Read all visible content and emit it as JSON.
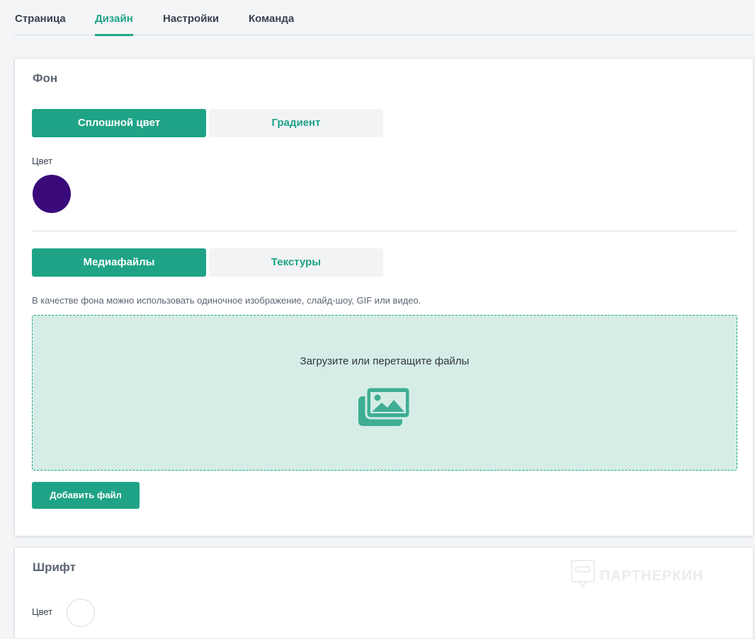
{
  "tabs": [
    {
      "label": "Страница"
    },
    {
      "label": "Дизайн"
    },
    {
      "label": "Настройки"
    },
    {
      "label": "Команда"
    }
  ],
  "background_section": {
    "title": "Фон",
    "color_mode": {
      "solid_label": "Сплошной цвет",
      "gradient_label": "Градиент",
      "selected": "solid"
    },
    "color_label": "Цвет",
    "color_value": "#3a0a7a",
    "media_mode": {
      "media_label": "Медиафайлы",
      "textures_label": "Текстуры",
      "selected": "media"
    },
    "hint": "В качестве фона можно использовать одиночное изображение, слайд-шоу, GIF или видео.",
    "dropzone_text": "Загрузите или перетащите файлы",
    "dropzone_icon": "images-icon",
    "add_button_label": "Добавить файл"
  },
  "font_section": {
    "title": "Шрифт",
    "color_label": "Цвет",
    "color_value": "#ffffff"
  },
  "watermark": {
    "text": "ПАРТНЕРКИН"
  },
  "colors": {
    "accent": "#1fa386",
    "dropzone_bg": "#d5ede6"
  }
}
